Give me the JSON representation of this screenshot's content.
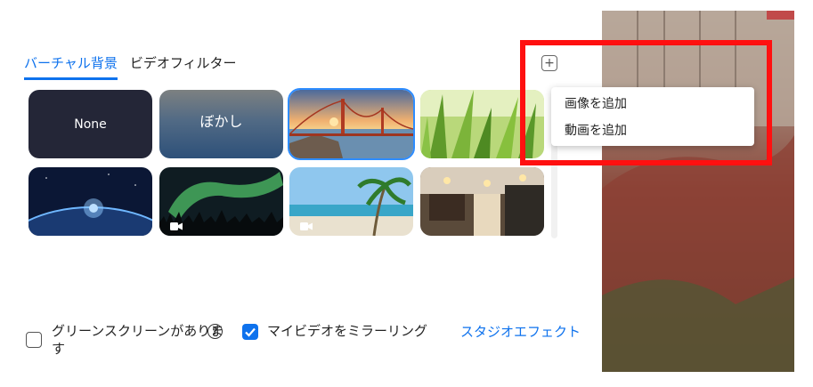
{
  "tabs": [
    {
      "label": "バーチャル背景",
      "active": true
    },
    {
      "label": "ビデオフィルター",
      "active": false
    }
  ],
  "thumbnails": [
    {
      "label": "None",
      "kind": "none"
    },
    {
      "label": "ぼかし",
      "kind": "blur"
    },
    {
      "label": "",
      "kind": "golden-gate",
      "selected": true
    },
    {
      "label": "",
      "kind": "grass"
    },
    {
      "label": "",
      "kind": "earth"
    },
    {
      "label": "",
      "kind": "aurora",
      "video": true
    },
    {
      "label": "",
      "kind": "beach",
      "video": true
    },
    {
      "label": "",
      "kind": "cafe"
    }
  ],
  "menu": {
    "items": [
      "画像を追加",
      "動画を追加"
    ]
  },
  "bottom": {
    "greenscreen_label": "グリーンスクリーンがありま",
    "greenscreen_label_wrap": "す",
    "mirror_label": "マイビデオをミラーリング",
    "studio_link": "スタジオエフェクト"
  },
  "colors": {
    "accent": "#0e72ed",
    "highlight": "#ff1010"
  }
}
